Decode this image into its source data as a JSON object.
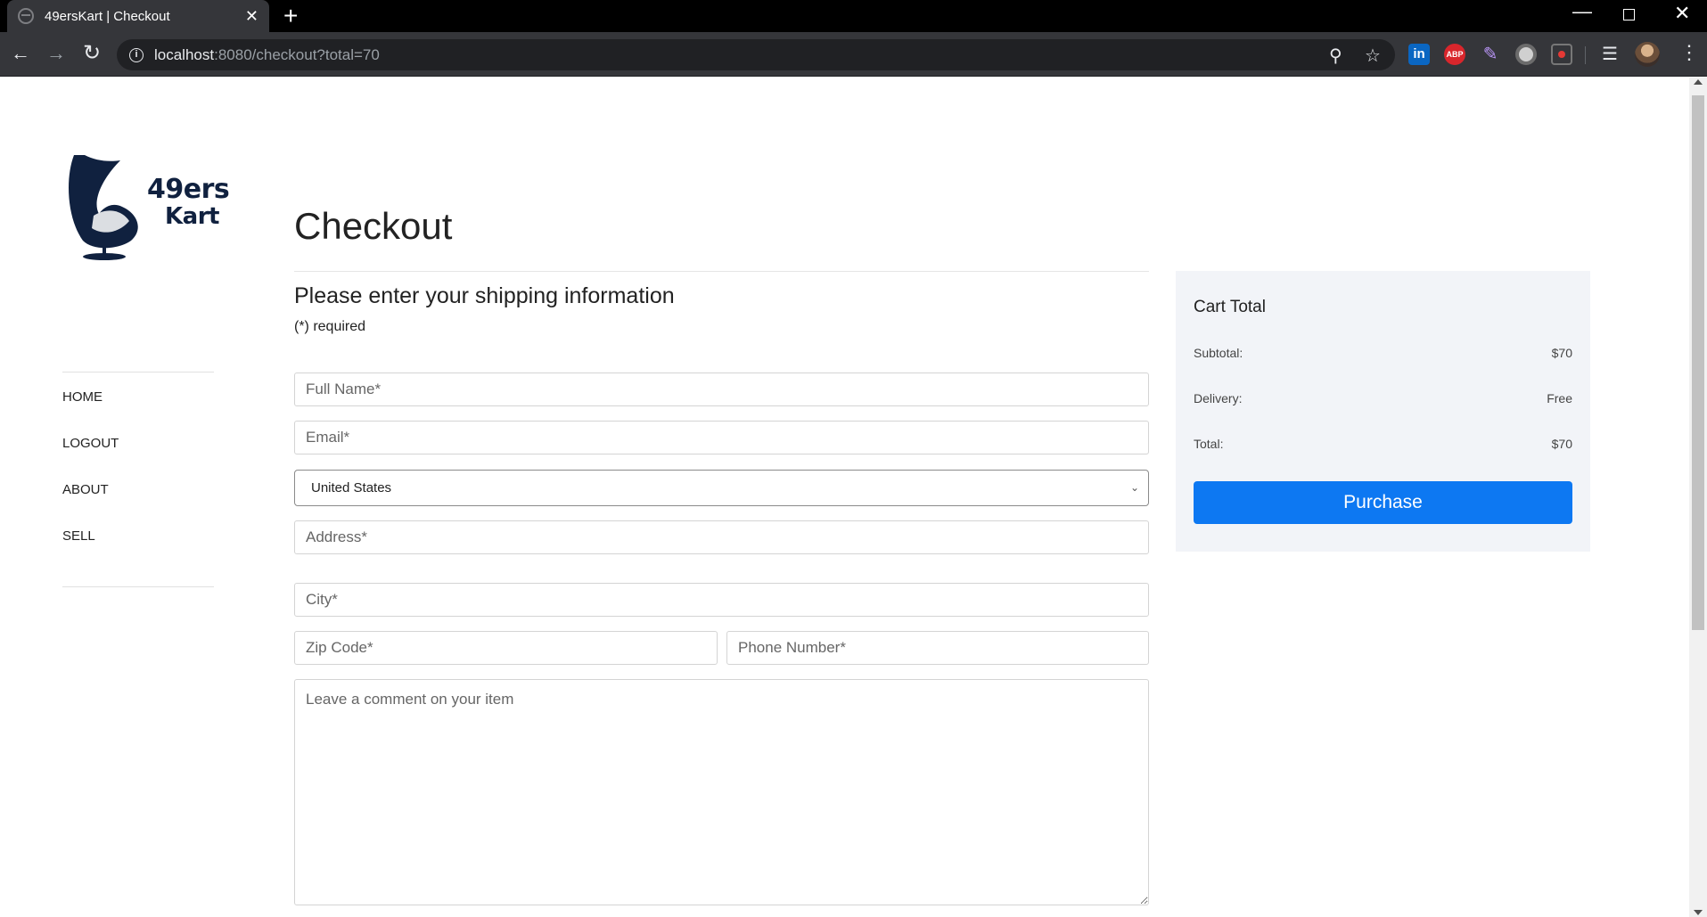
{
  "browser": {
    "tab_title": "49ersKart | Checkout",
    "tab_close": "✕",
    "new_tab": "+",
    "url_host": "localhost",
    "url_rest": ":8080/checkout?total=70",
    "extension_linkedin": "in",
    "extension_abp": "ABP"
  },
  "logo": {
    "line1": "49ers",
    "line2": "Kart",
    "color": "#10213f"
  },
  "nav": [
    "HOME",
    "LOGOUT",
    "ABOUT",
    "SELL"
  ],
  "checkout": {
    "title": "Checkout",
    "subtitle": "Please enter your shipping information",
    "required_note": "(*) required",
    "placeholders": {
      "full_name": "Full Name*",
      "email": "Email*",
      "address": "Address*",
      "city": "City*",
      "zip": "Zip Code*",
      "phone": "Phone Number*",
      "comment": "Leave a comment on your item"
    },
    "country": "United States"
  },
  "cart": {
    "title": "Cart Total",
    "subtotal_label": "Subtotal:",
    "subtotal_value": "$70",
    "delivery_label": "Delivery:",
    "delivery_value": "Free",
    "total_label": "Total:",
    "total_value": "$70",
    "purchase_label": "Purchase",
    "button_color": "#0d78f2"
  }
}
